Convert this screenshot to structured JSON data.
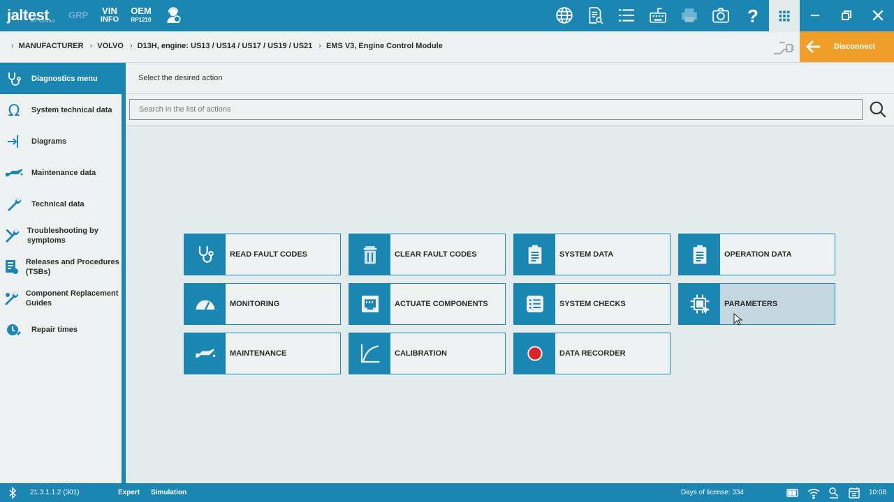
{
  "topbar": {
    "logo": "jaltest",
    "logo_sub": "BY COJALI",
    "grp": "GRP",
    "vin_line1": "VIN",
    "vin_line2": "INFO",
    "oem_line1": "OEM",
    "oem_line2": "RP1210",
    "icons": [
      "support-agent-icon",
      "globe-icon",
      "document-search-icon",
      "list-icon",
      "keyboard-icon",
      "printer-icon",
      "camera-icon",
      "help-icon",
      "apps-grid-icon",
      "minimize-icon",
      "restore-icon",
      "close-icon"
    ]
  },
  "breadcrumb": {
    "items": [
      "MANUFACTURER",
      "VOLVO",
      "D13H, engine: US13 / US14 / US17 / US19 / US21",
      "EMS V3, Engine Control Module"
    ],
    "disconnect_label": "Disconnect"
  },
  "sidebar": {
    "items": [
      {
        "label": "Diagnostics menu",
        "icon": "stethoscope-icon"
      },
      {
        "label": "System technical data",
        "icon": "omega-icon"
      },
      {
        "label": "Diagrams",
        "icon": "diagram-icon"
      },
      {
        "label": "Maintenance data",
        "icon": "oil-can-icon"
      },
      {
        "label": "Technical data",
        "icon": "wrench-icon"
      },
      {
        "label": "Troubleshooting by symptoms",
        "icon": "tools-icon"
      },
      {
        "label": "Releases and Procedures (TSBs)",
        "icon": "releases-icon"
      },
      {
        "label": "Component Replacement Guides",
        "icon": "component-replace-icon"
      },
      {
        "label": "Repair times",
        "icon": "repair-times-icon"
      }
    ]
  },
  "main": {
    "header": "Select the desired action",
    "search_placeholder": "Search in the list of actions",
    "tiles": [
      {
        "label": "READ FAULT CODES",
        "icon": "stethoscope-icon"
      },
      {
        "label": "CLEAR FAULT CODES",
        "icon": "trash-icon"
      },
      {
        "label": "SYSTEM DATA",
        "icon": "clipboard-icon"
      },
      {
        "label": "OPERATION DATA",
        "icon": "clipboard-icon"
      },
      {
        "label": "MONITORING",
        "icon": "gauge-icon"
      },
      {
        "label": "ACTUATE COMPONENTS",
        "icon": "connector-icon"
      },
      {
        "label": "SYSTEM CHECKS",
        "icon": "checklist-icon"
      },
      {
        "label": "PARAMETERS",
        "icon": "chip-icon"
      },
      {
        "label": "MAINTENANCE",
        "icon": "oil-can-icon"
      },
      {
        "label": "CALIBRATION",
        "icon": "curve-icon"
      },
      {
        "label": "DATA RECORDER",
        "icon": "record-icon"
      }
    ]
  },
  "statusbar": {
    "version": "21.3.1.1.2 (301)",
    "mode": "Expert",
    "simulation": "Simulation",
    "license": "Days of license: 334",
    "time": "10:08"
  },
  "colors": {
    "primary": "#1c86b3",
    "accent": "#f0a02a",
    "record": "#d8232a"
  }
}
